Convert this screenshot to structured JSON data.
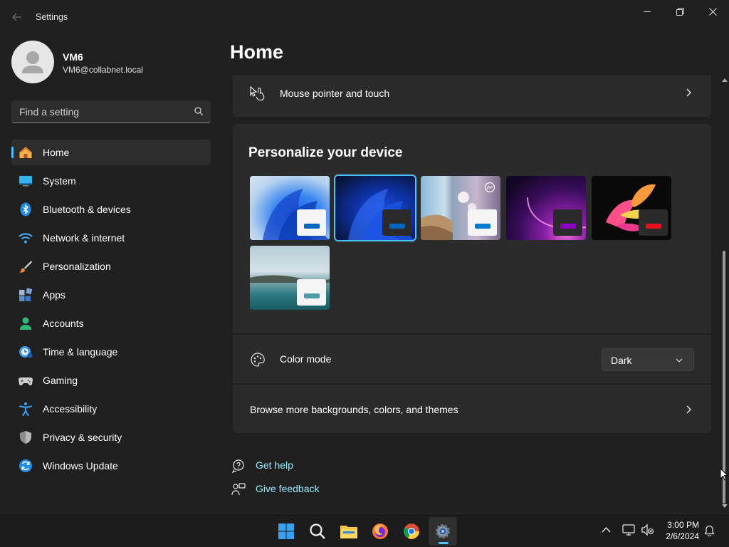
{
  "window": {
    "app_title": "Settings",
    "back_icon": "back-arrow-icon",
    "controls": [
      "minimize-icon",
      "restore-icon",
      "close-icon"
    ]
  },
  "user": {
    "name": "VM6",
    "email": "VM6@collabnet.local"
  },
  "search": {
    "placeholder": "Find a setting",
    "value": ""
  },
  "nav": {
    "items": [
      {
        "label": "Home",
        "icon": "home-icon",
        "active": true
      },
      {
        "label": "System",
        "icon": "system-icon"
      },
      {
        "label": "Bluetooth & devices",
        "icon": "bluetooth-icon"
      },
      {
        "label": "Network & internet",
        "icon": "wifi-icon"
      },
      {
        "label": "Personalization",
        "icon": "brush-icon"
      },
      {
        "label": "Apps",
        "icon": "apps-icon"
      },
      {
        "label": "Accounts",
        "icon": "accounts-icon"
      },
      {
        "label": "Time & language",
        "icon": "clock-globe-icon"
      },
      {
        "label": "Gaming",
        "icon": "gamepad-icon"
      },
      {
        "label": "Accessibility",
        "icon": "accessibility-icon"
      },
      {
        "label": "Privacy & security",
        "icon": "shield-icon"
      },
      {
        "label": "Windows Update",
        "icon": "update-icon"
      }
    ]
  },
  "main": {
    "title": "Home",
    "mouse_row": {
      "label": "Mouse pointer and touch",
      "icon": "mouse-touch-icon"
    },
    "personalize": {
      "heading": "Personalize your device",
      "themes": [
        {
          "name": "windows-light",
          "selected": false,
          "accent": "#0067c0"
        },
        {
          "name": "windows-dark",
          "selected": true,
          "accent": "#0067c0"
        },
        {
          "name": "glow",
          "selected": false,
          "accent": "#0078d4"
        },
        {
          "name": "captured-motion",
          "selected": false,
          "accent": "#8b00c2"
        },
        {
          "name": "flow",
          "selected": false,
          "accent": "#e81123"
        },
        {
          "name": "sunrise",
          "selected": false,
          "accent": "#4a9aa8"
        }
      ],
      "color_mode": {
        "label": "Color mode",
        "icon": "palette-icon",
        "value": "Dark"
      },
      "browse": {
        "label": "Browse more backgrounds, colors, and themes"
      }
    },
    "links": [
      {
        "label": "Get help",
        "icon": "help-icon"
      },
      {
        "label": "Give feedback",
        "icon": "feedback-icon"
      }
    ]
  },
  "taskbar": {
    "apps": [
      "start-icon",
      "search-icon",
      "file-explorer-icon",
      "firefox-icon",
      "chrome-icon",
      "settings-icon"
    ],
    "tray": [
      "chevron-up-icon",
      "network-icon",
      "volume-muted-icon",
      "notification-icon"
    ],
    "time": "3:00 PM",
    "date": "2/6/2024"
  },
  "colors": {
    "accent": "#4cc2ff",
    "background": "#202020",
    "card": "#2b2b2b",
    "link": "#99ebff"
  }
}
